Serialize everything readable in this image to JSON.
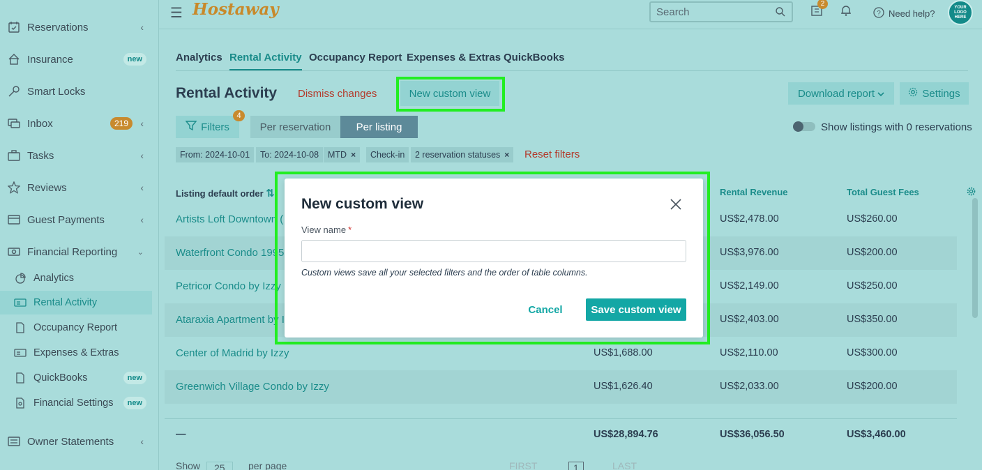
{
  "colors": {
    "accent": "#13a7a5",
    "brand": "#c8892a",
    "danger": "#b33a2b",
    "highlight": "#22ee22"
  },
  "sidebar": {
    "items": [
      {
        "label": "Reservations",
        "icon": "calendar-check-icon"
      },
      {
        "label": "Insurance",
        "icon": "home-shield-icon",
        "badge": "new"
      },
      {
        "label": "Smart Locks",
        "icon": "key-icon"
      },
      {
        "label": "Inbox",
        "icon": "chat-icon",
        "count": "219"
      },
      {
        "label": "Tasks",
        "icon": "briefcase-icon"
      },
      {
        "label": "Reviews",
        "icon": "star-icon"
      },
      {
        "label": "Guest Payments",
        "icon": "credit-card-icon"
      },
      {
        "label": "Financial Reporting",
        "icon": "money-icon"
      },
      {
        "label": "Owner Statements",
        "icon": "statement-icon"
      }
    ],
    "sub_items": [
      {
        "label": "Analytics",
        "icon": "pie-chart-icon"
      },
      {
        "label": "Rental Activity",
        "icon": "money-icon",
        "active": true
      },
      {
        "label": "Occupancy Report",
        "icon": "doc-icon"
      },
      {
        "label": "Expenses & Extras",
        "icon": "money-icon"
      },
      {
        "label": "QuickBooks",
        "icon": "doc-icon",
        "badge": "new"
      },
      {
        "label": "Financial Settings",
        "icon": "doc-gear-icon",
        "badge": "new"
      }
    ]
  },
  "header": {
    "logo": "Hostaway",
    "search_placeholder": "Search",
    "notif_count": "2",
    "help": "Need help?",
    "avatar": "YOUR LOGO HERE"
  },
  "tabs": [
    "Analytics",
    "Rental Activity",
    "Occupancy Report",
    "Expenses & Extras",
    "QuickBooks"
  ],
  "page": {
    "title": "Rental Activity",
    "dismiss": "Dismiss changes",
    "new_view": "New custom view",
    "download": "Download report",
    "settings": "Settings",
    "filters": "Filters",
    "filters_count": "4",
    "per_reservation": "Per reservation",
    "per_listing": "Per listing",
    "toggle_label": "Show listings with 0 reservations",
    "chips": [
      "From: 2024-10-01",
      "To: 2024-10-08",
      "MTD",
      "Check-in",
      "2 reservation statuses"
    ],
    "reset": "Reset filters"
  },
  "table": {
    "headers": {
      "listing": "Listing default order",
      "rental_revenue": "Rental Revenue",
      "guest_fees": "Total Guest Fees"
    },
    "rows": [
      {
        "name": "Artists Loft Downtown (",
        "mid": "",
        "rev": "US$2,478.00",
        "fees": "US$260.00"
      },
      {
        "name": "Waterfront Condo 1995",
        "mid": "",
        "rev": "US$3,976.00",
        "fees": "US$200.00"
      },
      {
        "name": "Petricor Condo by Izzy",
        "mid": "",
        "rev": "US$2,149.00",
        "fees": "US$250.00"
      },
      {
        "name": "Ataraxia Apartment by Iz",
        "mid": "",
        "rev": "US$2,403.00",
        "fees": "US$350.00"
      },
      {
        "name": "Center of Madrid by Izzy",
        "mid": "US$1,688.00",
        "rev": "US$2,110.00",
        "fees": "US$300.00"
      },
      {
        "name": "Greenwich Village Condo by Izzy",
        "mid": "US$1,626.40",
        "rev": "US$2,033.00",
        "fees": "US$200.00"
      }
    ],
    "totals": {
      "dash": "—",
      "mid": "US$28,894.76",
      "rev": "US$36,056.50",
      "fees": "US$3,460.00"
    }
  },
  "modal": {
    "title": "New custom view",
    "field_label": "View name",
    "required_mark": "*",
    "input_value": "",
    "help": "Custom views save all your selected filters and the order of table columns.",
    "cancel": "Cancel",
    "save": "Save custom view"
  },
  "pager": {
    "show": "Show",
    "per_page_value": "25",
    "per_page": "per page",
    "first": "FIRST",
    "page": "1",
    "last": "LAST"
  }
}
